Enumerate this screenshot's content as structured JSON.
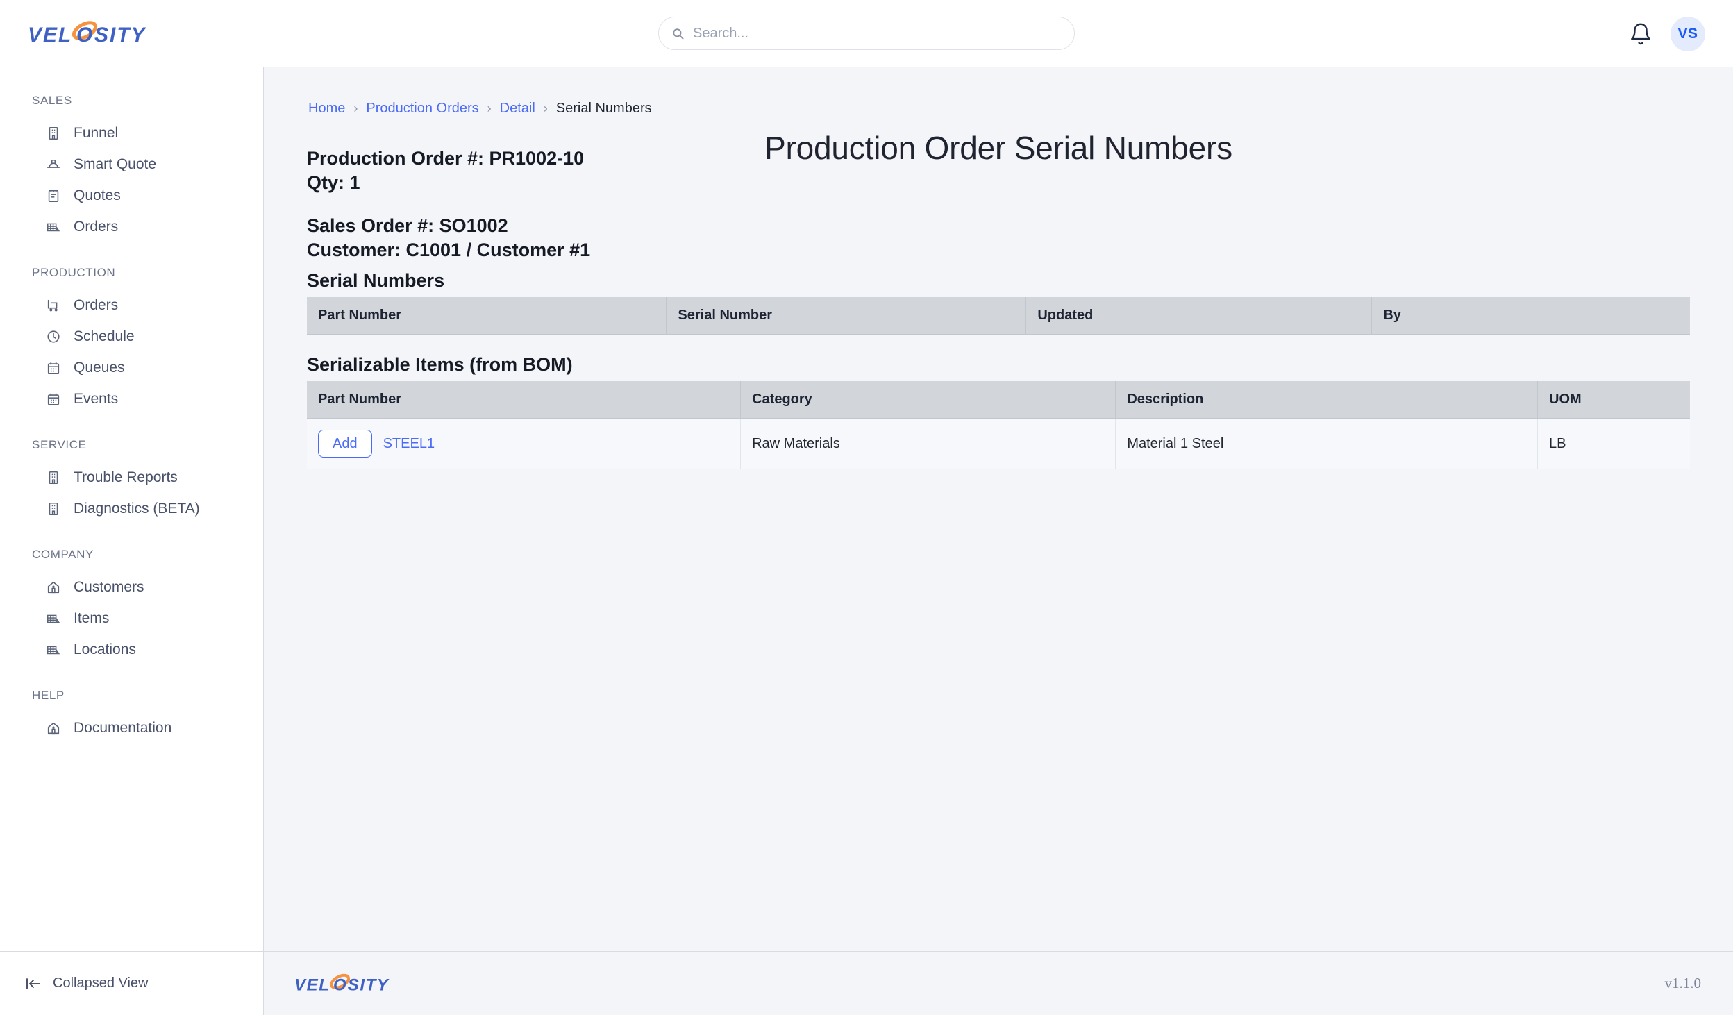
{
  "brand": {
    "name": "VELOSITY",
    "text_before": "VEL",
    "text_after": "SITY",
    "blue": "#3f61c4",
    "orange": "#f59440"
  },
  "header": {
    "search": {
      "placeholder": "Search...",
      "value": "",
      "icon": "search-icon"
    },
    "notifications_icon": "bell-icon",
    "avatar_initials": "VS"
  },
  "sidebar": {
    "sections": [
      {
        "title": "SALES",
        "items": [
          {
            "label": "Funnel",
            "icon": "building-icon"
          },
          {
            "label": "Smart Quote",
            "icon": "hard-hat-icon"
          },
          {
            "label": "Quotes",
            "icon": "clipboard-icon"
          },
          {
            "label": "Orders",
            "icon": "warehouse-icon"
          }
        ]
      },
      {
        "title": "PRODUCTION",
        "items": [
          {
            "label": "Orders",
            "icon": "cart-icon"
          },
          {
            "label": "Schedule",
            "icon": "clock-icon"
          },
          {
            "label": "Queues",
            "icon": "calendar-icon"
          },
          {
            "label": "Events",
            "icon": "calendar-icon"
          }
        ]
      },
      {
        "title": "SERVICE",
        "items": [
          {
            "label": "Trouble Reports",
            "icon": "building-icon"
          },
          {
            "label": "Diagnostics (BETA)",
            "icon": "building-icon"
          }
        ]
      },
      {
        "title": "COMPANY",
        "items": [
          {
            "label": "Customers",
            "icon": "home-icon"
          },
          {
            "label": "Items",
            "icon": "warehouse-icon"
          },
          {
            "label": "Locations",
            "icon": "warehouse-icon"
          }
        ]
      },
      {
        "title": "HELP",
        "items": [
          {
            "label": "Documentation",
            "icon": "home-icon"
          }
        ]
      }
    ],
    "collapse_label": "Collapsed View",
    "collapse_icon": "collapse-left-icon"
  },
  "breadcrumb": {
    "items": [
      {
        "label": "Home",
        "current": false
      },
      {
        "label": "Production Orders",
        "current": false
      },
      {
        "label": "Detail",
        "current": false
      },
      {
        "label": "Serial Numbers",
        "current": true
      }
    ],
    "separator": "›"
  },
  "page": {
    "title": "Production Order Serial Numbers",
    "production_order_line": "Production Order #: PR1002-10",
    "qty_line": "Qty: 1",
    "sales_order_line": "Sales Order #: SO1002",
    "customer_line": "Customer: C1001 / Customer #1"
  },
  "serial_numbers_table": {
    "heading": "Serial Numbers",
    "columns": [
      "Part Number",
      "Serial Number",
      "Updated",
      "By"
    ],
    "rows": []
  },
  "serializable_items_table": {
    "heading": "Serializable Items (from BOM)",
    "columns": [
      "Part Number",
      "Category",
      "Description",
      "UOM"
    ],
    "rows": [
      {
        "add_label": "Add",
        "part_number": "STEEL1",
        "category": "Raw Materials",
        "description": "Material 1 Steel",
        "uom": "LB"
      }
    ]
  },
  "footer": {
    "version": "v1.1.0"
  },
  "colors": {
    "accent_blue": "#4a6bf5",
    "link_blue": "#4a6bf5",
    "avatar_bg": "#e3ebfd",
    "avatar_text": "#1a5cf5",
    "table_header_bg": "#d2d5da",
    "page_bg": "#f4f5f9"
  }
}
